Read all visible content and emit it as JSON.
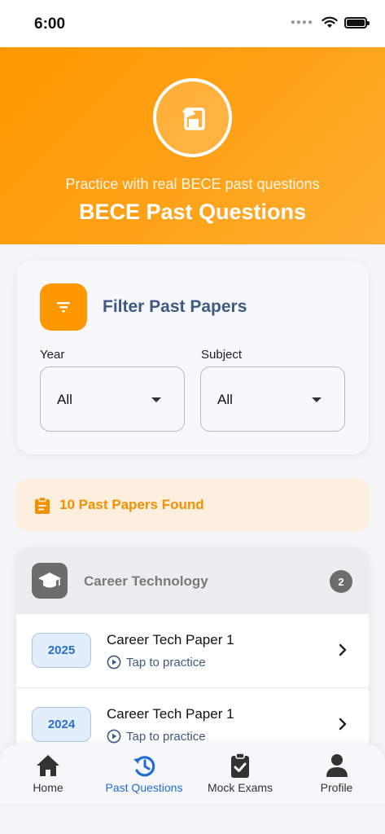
{
  "status_bar": {
    "time": "6:00",
    "icons": [
      "cellular-dots-icon",
      "wifi-icon",
      "battery-icon"
    ]
  },
  "hero": {
    "icon": "exam-paper-icon",
    "subtitle": "Practice with real BECE past questions",
    "title": "BECE Past Questions",
    "gradient_colors": [
      "#ff9800",
      "#ffae33"
    ]
  },
  "filter": {
    "icon": "filter-icon",
    "title": "Filter Past Papers",
    "year_label": "Year",
    "year_value": "All",
    "subject_label": "Subject",
    "subject_value": "All"
  },
  "results": {
    "icon": "clipboard-icon",
    "text": "10 Past Papers Found"
  },
  "subject_group": {
    "icon": "graduation-cap-icon",
    "name": "Career Technology",
    "count": "2",
    "papers": [
      {
        "year": "2025",
        "title": "Career Tech Paper 1",
        "action": "Tap to practice"
      },
      {
        "year": "2024",
        "title": "Career Tech Paper 1",
        "action": "Tap to practice"
      }
    ]
  },
  "bottom_nav": {
    "active": "Past Questions",
    "items": [
      {
        "label": "Home",
        "icon": "home-icon"
      },
      {
        "label": "Past Questions",
        "icon": "history-icon"
      },
      {
        "label": "Mock Exams",
        "icon": "clipboard-check-icon"
      },
      {
        "label": "Profile",
        "icon": "person-icon"
      }
    ]
  },
  "colors": {
    "accent_orange": "#ff9800",
    "title_blue": "#3f5a80",
    "active_blue": "#1e6fd1",
    "banner_bg": "#fdeedd"
  }
}
